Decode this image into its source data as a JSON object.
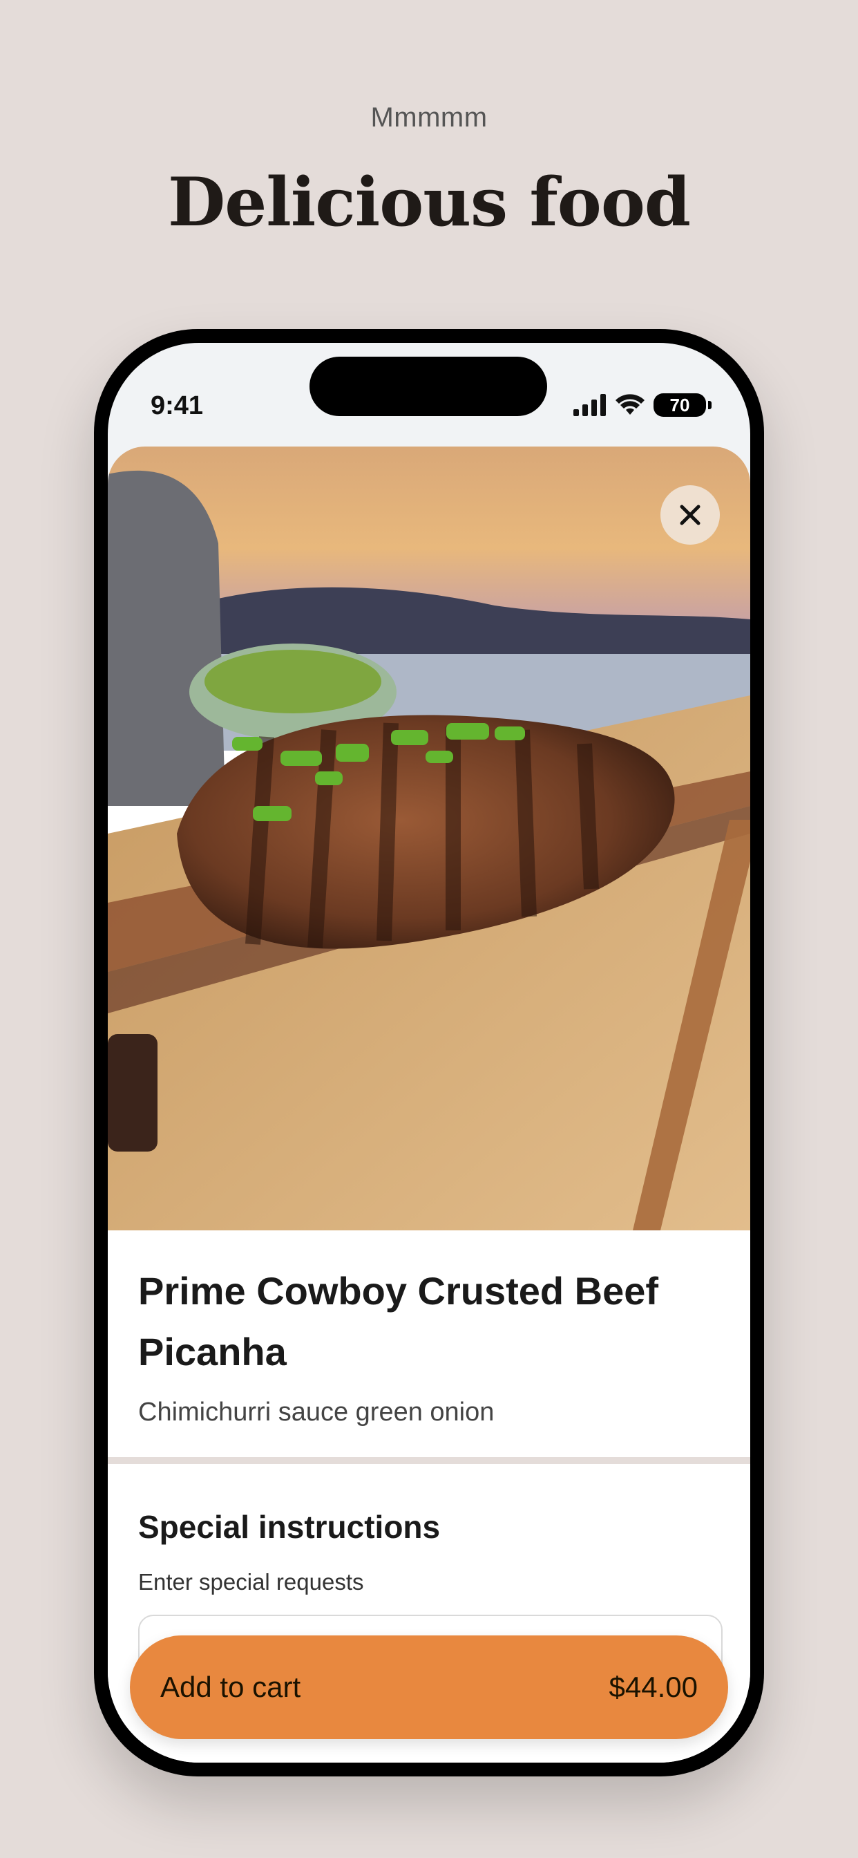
{
  "page": {
    "eyebrow": "Mmmmm",
    "headline": "Delicious food"
  },
  "status_bar": {
    "time": "9:41",
    "battery": "70",
    "icons": [
      "cellular-signal-icon",
      "wifi-icon",
      "battery-icon"
    ]
  },
  "item": {
    "image_icon": "food-photo",
    "close_icon": "close-icon",
    "title": "Prime Cowboy Crusted Beef Picanha",
    "description": "Chimichurri sauce green onion"
  },
  "special_instructions": {
    "title": "Special instructions",
    "subtitle": "Enter special requests",
    "value": ""
  },
  "cart_button": {
    "label": "Add to cart",
    "price": "$44.00"
  },
  "colors": {
    "page_background": "#e4dcd9",
    "accent": "#e8883f",
    "sheet": "#ffffff"
  }
}
